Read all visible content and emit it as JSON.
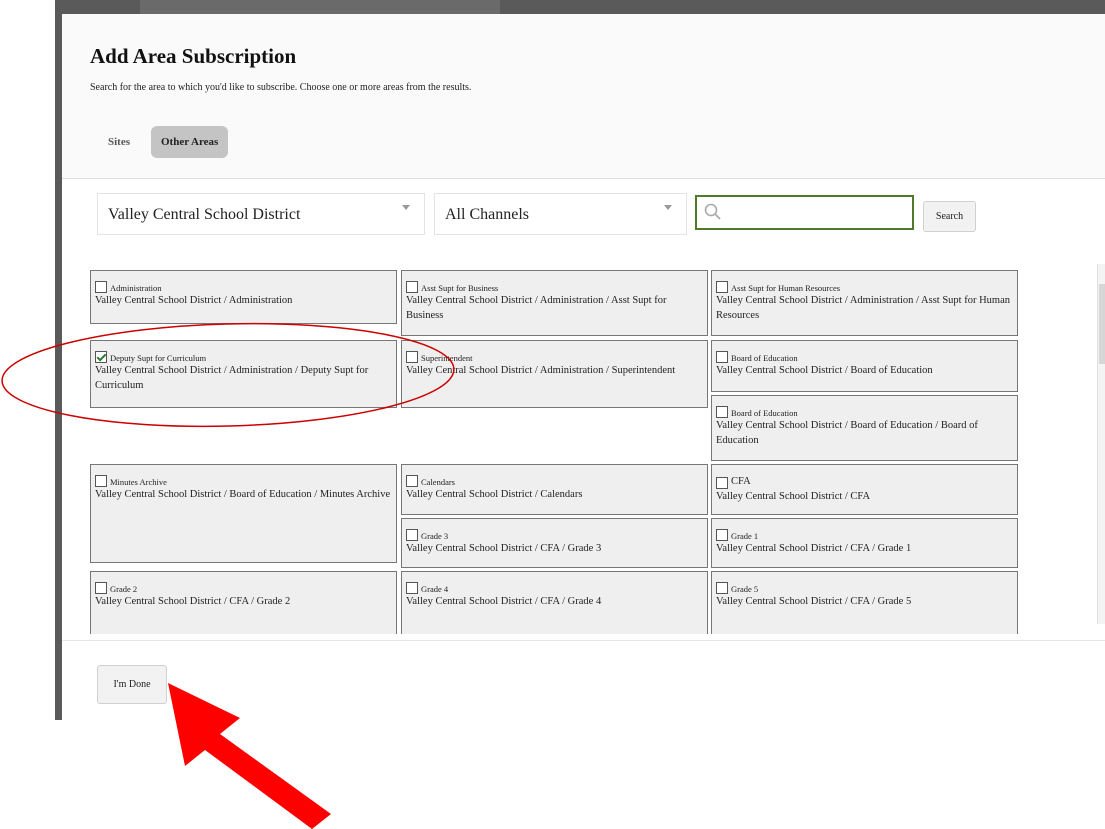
{
  "modal": {
    "title": "Add Area Subscription",
    "subtitle": "Search for the area to which you'd like to subscribe. Choose one or more areas from the results."
  },
  "tabs": [
    {
      "label": "Sites",
      "active": false
    },
    {
      "label": "Other Areas",
      "active": true
    }
  ],
  "filters": {
    "district": "Valley Central School District",
    "channel": "All Channels",
    "search_value": "",
    "search_button": "Search"
  },
  "results": [
    {
      "name": "Administration",
      "path": "Valley Central School District / Administration",
      "checked": false
    },
    {
      "name": "Asst Supt for Business",
      "path": "Valley Central School District / Administration / Asst Supt for Business",
      "checked": false
    },
    {
      "name": "Asst Supt for Human Resources",
      "path": "Valley Central School District / Administration / Asst Supt for Human Resources",
      "checked": false
    },
    {
      "name": "Deputy Supt for Curriculum",
      "path": "Valley Central School District / Administration / Deputy Supt for Curriculum",
      "checked": true
    },
    {
      "name": "Superintendent",
      "path": "Valley Central School District / Administration / Superintendent",
      "checked": false
    },
    {
      "name": "Board of Education",
      "path": "Valley Central School District / Board of Education",
      "checked": false
    },
    {
      "name": "Board of Education",
      "path": "Valley Central School District / Board of Education / Board of Education",
      "checked": false
    },
    {
      "name": "Minutes Archive",
      "path": "Valley Central School District / Board of Education / Minutes Archive",
      "checked": false
    },
    {
      "name": "Calendars",
      "path": "Valley Central School District / Calendars",
      "checked": false
    },
    {
      "name": "CFA",
      "path": "Valley Central School District / CFA",
      "checked": false
    },
    {
      "name": "Grade 3",
      "path": "Valley Central School District / CFA / Grade 3",
      "checked": false
    },
    {
      "name": "Grade 1",
      "path": "Valley Central School District / CFA / Grade 1",
      "checked": false
    },
    {
      "name": "Grade 2",
      "path": "Valley Central School District / CFA / Grade 2",
      "checked": false
    },
    {
      "name": "Grade 4",
      "path": "Valley Central School District / CFA / Grade 4",
      "checked": false
    },
    {
      "name": "Grade 5",
      "path": "Valley Central School District / CFA / Grade 5",
      "checked": false
    }
  ],
  "footer": {
    "done_label": "I'm Done"
  },
  "colors": {
    "search_border": "#4e7a2a",
    "annotation_red": "#ff0000",
    "ellipse_red": "#cc0000",
    "checkmark": "#2e7d32"
  },
  "icons": {
    "search": "search-icon",
    "dropdown": "chevron-down-icon",
    "check": "checkmark-icon"
  }
}
